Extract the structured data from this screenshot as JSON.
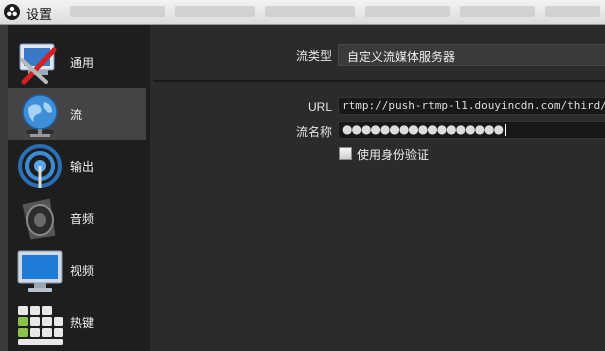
{
  "window": {
    "title": "设置"
  },
  "sidebar": {
    "items": [
      {
        "label": "通用",
        "icon": "tools-icon"
      },
      {
        "label": "流",
        "icon": "globe-icon"
      },
      {
        "label": "输出",
        "icon": "broadcast-icon"
      },
      {
        "label": "音频",
        "icon": "speaker-icon"
      },
      {
        "label": "视频",
        "icon": "monitor-icon"
      },
      {
        "label": "热键",
        "icon": "keyboard-icon"
      }
    ],
    "active": "流"
  },
  "stream": {
    "service_label": "流类型",
    "service_value": "自定义流媒体服务器",
    "url_label": "URL",
    "url_value": "rtmp://push-rtmp-l1.douyincdn.com/third/",
    "key_label": "流名称",
    "key_value": "●●●●●●●●●●●●●●●●●",
    "auth_label": "使用身份验证",
    "auth_checked": false
  }
}
